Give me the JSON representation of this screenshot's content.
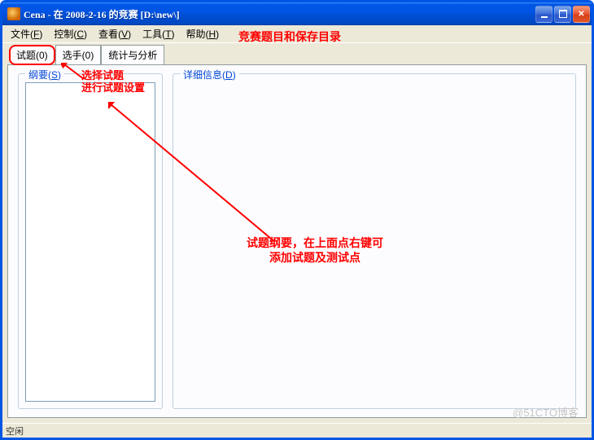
{
  "window": {
    "title": "Cena - 在 2008-2-16 的竞赛 [D:\\new\\]"
  },
  "menubar": {
    "items": [
      {
        "label": "文件",
        "hotkey": "F"
      },
      {
        "label": "控制",
        "hotkey": "C"
      },
      {
        "label": "查看",
        "hotkey": "V"
      },
      {
        "label": "工具",
        "hotkey": "T"
      },
      {
        "label": "帮助",
        "hotkey": "H"
      }
    ]
  },
  "tabs": {
    "items": [
      {
        "label": "试题(0)",
        "active": true
      },
      {
        "label": "选手(0)",
        "active": false
      },
      {
        "label": "统计与分析",
        "active": false
      }
    ]
  },
  "panel_left": {
    "label": "纲要",
    "hotkey": "S"
  },
  "panel_right": {
    "label": "详细信息",
    "hotkey": "D"
  },
  "statusbar": {
    "text": "空闲"
  },
  "annotations": {
    "title_note": "竞赛题目和保存目录",
    "select_note_l1": "选择试题",
    "select_note_l2": "进行试题设置",
    "center_note_l1": "试题纲要，在上面点右键可",
    "center_note_l2": "添加试题及测试点"
  },
  "watermark": "@51CTO博客"
}
